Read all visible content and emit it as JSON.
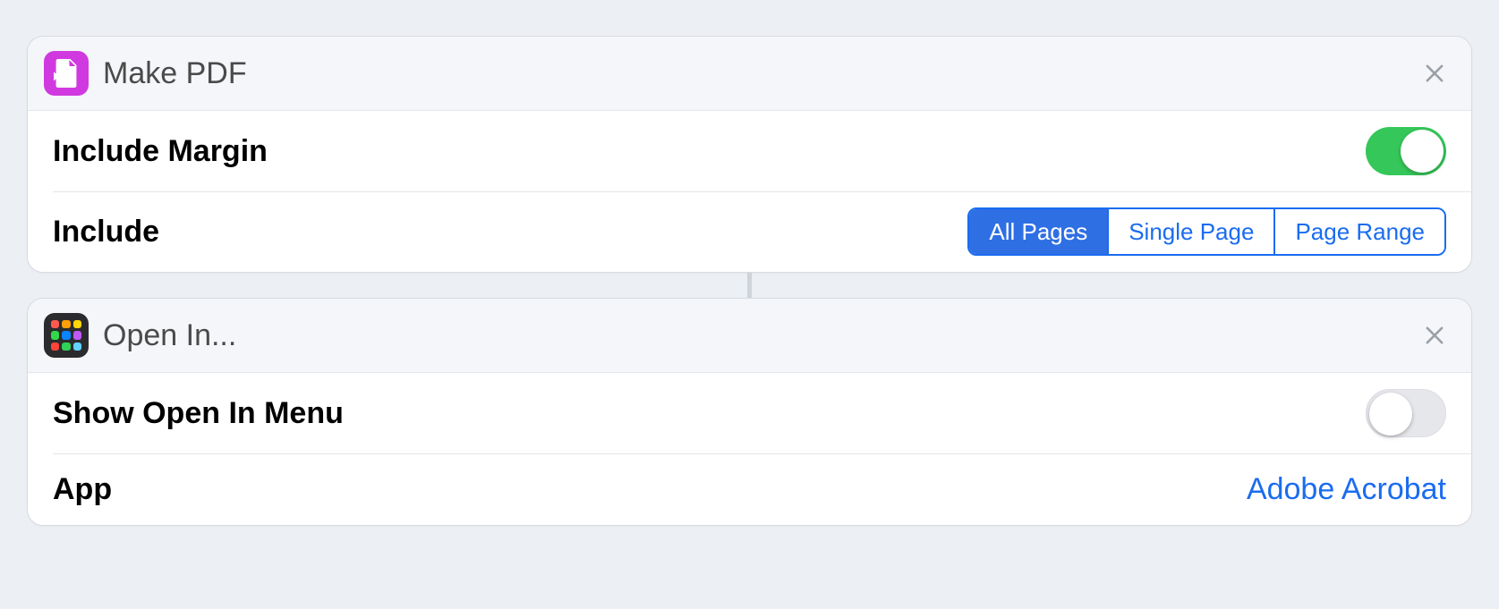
{
  "actions": {
    "makePdf": {
      "title": "Make PDF",
      "rows": {
        "includeMargin": {
          "label": "Include Margin",
          "toggleOn": true
        },
        "include": {
          "label": "Include",
          "options": [
            "All Pages",
            "Single Page",
            "Page Range"
          ],
          "selected": "All Pages"
        }
      }
    },
    "openIn": {
      "title": "Open In...",
      "rows": {
        "showMenu": {
          "label": "Show Open In Menu",
          "toggleOn": false
        },
        "app": {
          "label": "App",
          "value": "Adobe Acrobat"
        }
      }
    }
  }
}
